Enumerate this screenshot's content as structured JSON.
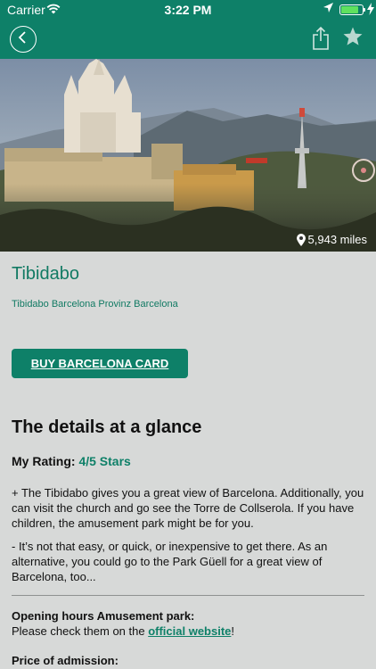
{
  "status": {
    "carrier": "Carrier",
    "time": "3:22 PM",
    "battery_level": 0.88,
    "icons": [
      "wifi-icon",
      "location-arrow-icon",
      "battery-icon",
      "charging-icon"
    ]
  },
  "nav": {
    "icons": [
      "back-chevron-icon",
      "share-icon",
      "star-icon"
    ]
  },
  "hero": {
    "distance": "5,943 miles"
  },
  "place": {
    "title": "Tibidabo",
    "subtitle": "Tibidabo Barcelona Provinz Barcelona"
  },
  "buy_button": "BUY BARCELONA CARD",
  "details": {
    "heading": "The details at a glance",
    "rating_label": "My Rating: ",
    "rating_value": "4/5 Stars",
    "pros": "+ The Tibidabo gives you a great view of Barcelona. Additionally, you can visit the church and go see the Torre de Collserola. If you have children, the amusement park might be for you.",
    "cons": "- It’s not that easy, or quick, or inexpensive to get there. As an alternative, you could go to the Park Güell for a great view of Barcelona, too...",
    "hours_title": "Opening hours Amusement park:",
    "hours_prefix": "Please check them on the ",
    "hours_link": "official website",
    "hours_suffix": "!",
    "price_title": "Price of admission:"
  },
  "colors": {
    "brand": "#0e8068",
    "background": "#d7d9d8",
    "link": "#0e8068"
  }
}
